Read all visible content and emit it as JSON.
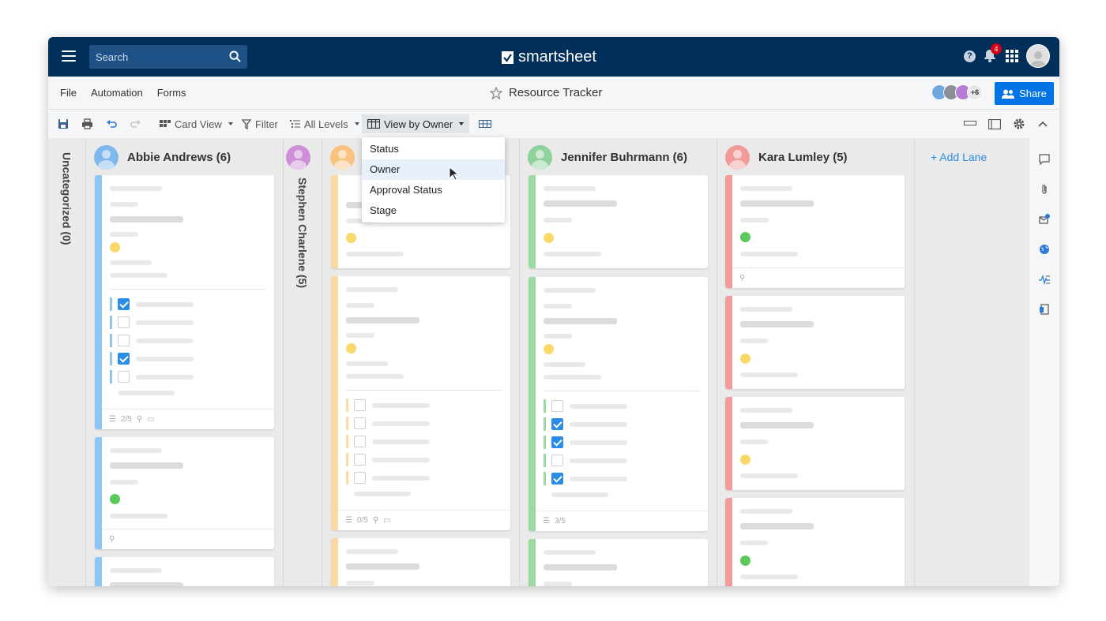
{
  "topbar": {
    "search_placeholder": "Search",
    "brand": "smartsheet",
    "notification_count": "4",
    "help_symbol": "?"
  },
  "menubar": {
    "items": [
      "File",
      "Automation",
      "Forms"
    ],
    "sheet_title": "Resource Tracker",
    "collaborators_more": "+6",
    "share_label": "Share"
  },
  "toolbar": {
    "card_view": "Card View",
    "filter": "Filter",
    "all_levels": "All Levels",
    "view_by": "View by Owner"
  },
  "dropdown": {
    "options": [
      "Status",
      "Owner",
      "Approval Status",
      "Stage"
    ],
    "highlighted": "Owner"
  },
  "lanes": {
    "uncategorized": "Uncategorized (0)",
    "abbie": "Abbie Andrews (6)",
    "stephen": "Stephen Charlene (5)",
    "jennifer": "Jennifer Buhrmann (6)",
    "kara": "Kara Lumley (5)",
    "add_lane": "+ Add Lane"
  },
  "card_footers": {
    "abbie_checklist": "2/5",
    "orange_checklist": "0/5",
    "jennifer_checklist": "3/5"
  },
  "colors": {
    "navy": "#003059",
    "accent": "#0073e6",
    "blue_stripe": "#8ec5f2",
    "orange_stripe": "#fbd9a4",
    "green_stripe": "#9bd9a0",
    "red_stripe": "#f19b9b",
    "yellow_dot": "#fad96b",
    "green_dot": "#5cc85c"
  }
}
